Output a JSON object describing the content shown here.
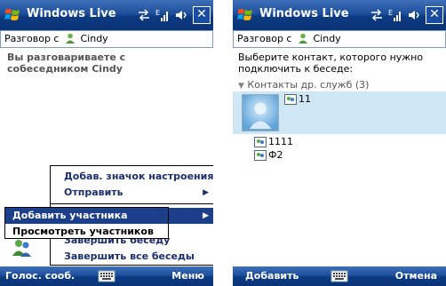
{
  "left_screen": {
    "title": "Windows Live",
    "conversation_prefix": "Разговор с",
    "contact_name": "Cindy",
    "message": "Вы разговариваете с собеседником Cindy",
    "menu": {
      "items": [
        {
          "label": "Добав. значок настроения"
        },
        {
          "label": "Отправить",
          "has_submenu": true
        },
        {
          "label": "Завершить беседу"
        },
        {
          "label": "Завершить все беседы"
        }
      ]
    },
    "submenu": {
      "items": [
        {
          "label": "Добавить участника",
          "selected": true,
          "has_submenu": true
        },
        {
          "label": "Просмотреть участников",
          "selected": false
        }
      ]
    },
    "softkey_left": "Голос. сооб.",
    "softkey_right": "Меню"
  },
  "right_screen": {
    "title": "Windows Live",
    "conversation_prefix": "Разговор с",
    "contact_name": "Cindy",
    "prompt": "Выберите контакт, которого нужно подключить к беседе:",
    "group_header": "Контакты др. служб (3)",
    "contacts": [
      {
        "name": "11",
        "selected": true
      },
      {
        "name": "1111",
        "selected": false
      },
      {
        "name": "Ф2",
        "selected": false
      }
    ],
    "softkey_left": "Добавить",
    "softkey_right": "Отмена"
  },
  "colors": {
    "titlebar": "#1d4f9c",
    "menu_text": "#1c2f6b",
    "selection": "#1c3f8a",
    "selected_row": "#cfe7f5"
  },
  "icons": [
    "windows-logo-icon",
    "network-icon",
    "signal-icon",
    "volume-icon",
    "close-icon",
    "buddy-icon",
    "contacts-icon",
    "keyboard-icon",
    "chevron-down-icon",
    "messenger-contact-icon"
  ]
}
